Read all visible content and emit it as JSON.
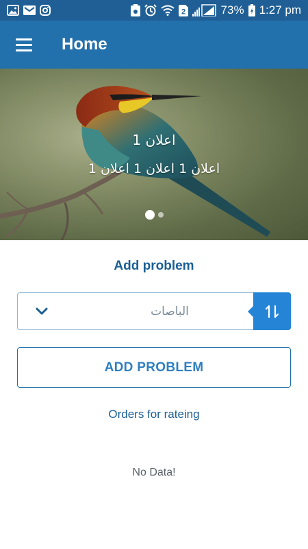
{
  "status_bar": {
    "icons_left": [
      "image-icon",
      "mail-icon",
      "instagram-icon"
    ],
    "icons_right": [
      "recorder-icon",
      "alarm-icon",
      "wifi-icon",
      "sim2-icon",
      "signal-icon",
      "battery-icon"
    ],
    "sim_label": "2",
    "battery": "73%",
    "time": "1:27 pm"
  },
  "app_bar": {
    "title": "Home",
    "color": "#2270ac"
  },
  "banner": {
    "title": "اعلان 1",
    "subtitle": "اعلان 1 اعلان 1 اعلان 1",
    "slides": 2,
    "active_slide": 1
  },
  "main": {
    "section_title": "Add problem",
    "dropdown_value": "الباصات",
    "add_button_label": "ADD PROBLEM",
    "orders_label": "Orders for rateing",
    "empty_text": "No Data!"
  },
  "colors": {
    "primary": "#2270ac",
    "status_bar": "#1f5f95",
    "accent": "#2684d6",
    "link": "#1a5f95"
  }
}
